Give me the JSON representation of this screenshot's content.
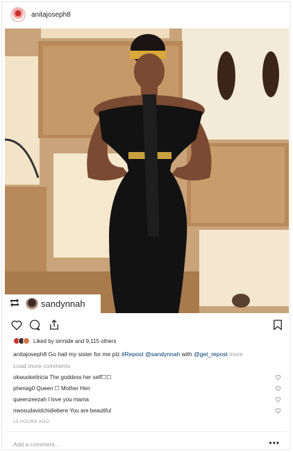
{
  "header": {
    "username": "anitajoseph8",
    "avatar_icon": "profile-avatar"
  },
  "repost": {
    "icon": "repost-icon",
    "username": "sandynnah"
  },
  "actions": {
    "like_icon": "heart-icon",
    "comment_icon": "comment-icon",
    "share_icon": "share-icon",
    "save_icon": "bookmark-icon"
  },
  "likes": {
    "text": "Liked by sirmide and 9,115 others"
  },
  "caption": {
    "username": "anitajoseph8",
    "text_before": " Go hail my sister for me plz ",
    "hashtag": "#Repost",
    "mention1": "@sandynnah",
    "with": " with ",
    "mention2": "@get_repost",
    "more": " more"
  },
  "load_more": "Load more comments",
  "comments": [
    {
      "username": "okwuokeitricia",
      "text": " The goddess her self☐☐"
    },
    {
      "username": "phenag0",
      "text": " Queen ☐ Mother Hen"
    },
    {
      "username": "queenzeezah",
      "text": " I love you mama"
    },
    {
      "username": "nwosudavidchidiebere",
      "text": " You are beautiful"
    }
  ],
  "timestamp": "13 HOURS AGO",
  "add_comment_placeholder": "Add a comment...",
  "more_options": "•••"
}
